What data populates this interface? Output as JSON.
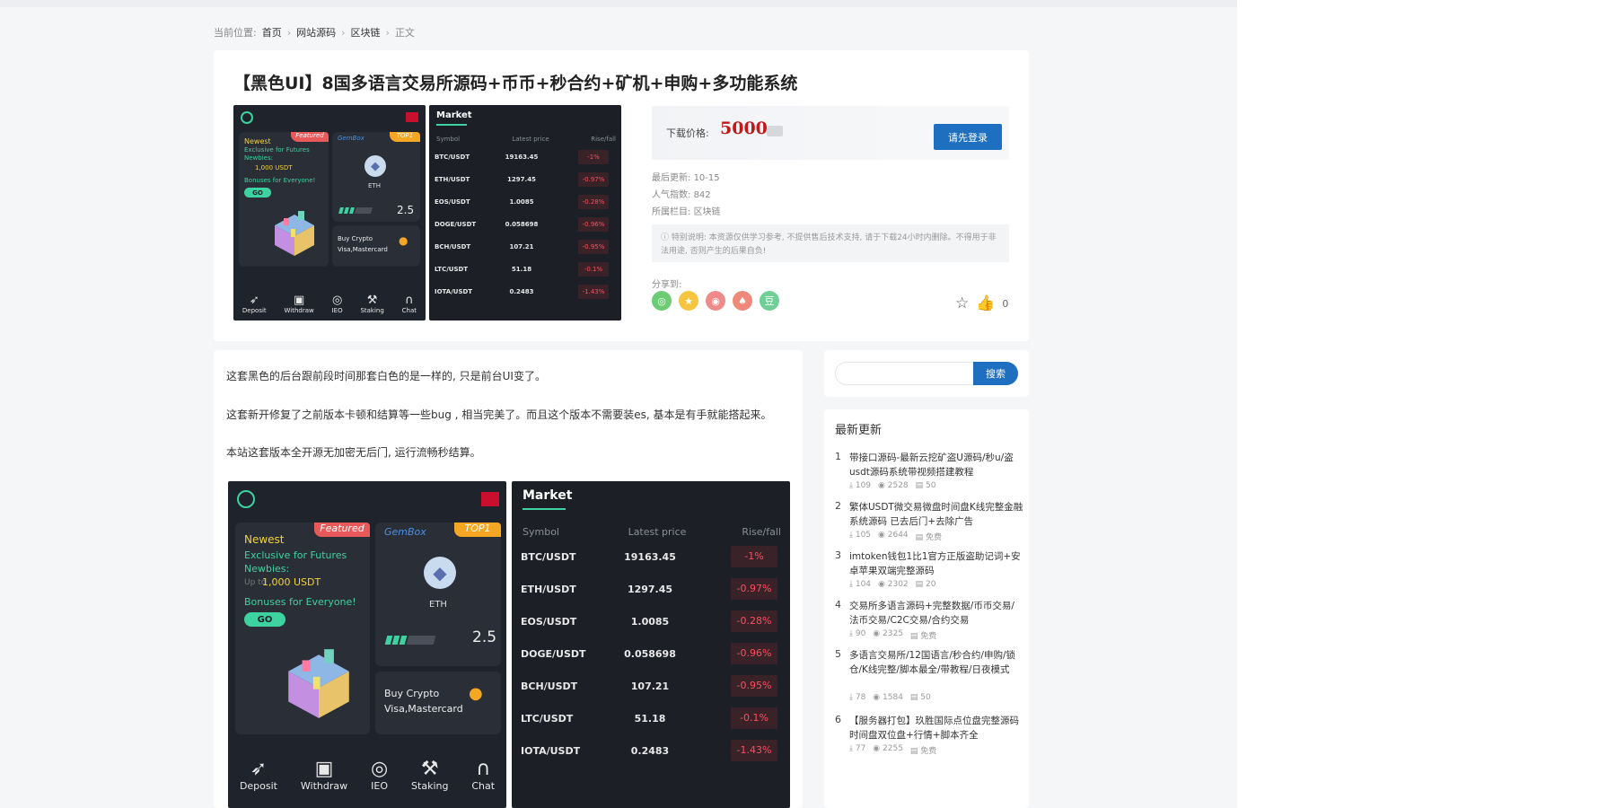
{
  "breadcrumb": {
    "prefix": "当前位置:",
    "items": [
      "首页",
      "网站源码",
      "区块链"
    ],
    "current": "正文"
  },
  "post": {
    "title": "【黑色UI】8国多语言交易所源码+币币+秒合约+矿机+申购+多功能系统",
    "price_label": "下载价格:",
    "price_value": "5000",
    "login_label": "请先登录",
    "meta": [
      {
        "label": "最后更新:",
        "value": "10-15"
      },
      {
        "label": "人气指数:",
        "value": "842"
      },
      {
        "label": "所属栏目:",
        "value": "区块链"
      }
    ],
    "notice": "ⓘ 特别说明: 本资源仅供学习参考, 不提供售后技术支持, 请于下载24小时内删除。不得用于非法用途, 否则产生的后果自负!",
    "share_label": "分享到:",
    "share_icons": [
      "wechat-icon",
      "qzone-icon",
      "weibo-icon",
      "qq-icon",
      "douban-icon"
    ],
    "share_glyphs": [
      "◎",
      "★",
      "◉",
      "♠",
      "豆"
    ],
    "like_count": "0"
  },
  "mockup": {
    "newest": "Newest",
    "featured": "Featured",
    "futures": "Exclusive for Futures Newbies:",
    "upto": "Up to",
    "amount": "1,000 USDT",
    "bonus": "Bonuses for Everyone!",
    "go": "GO",
    "gembox": "GemBox",
    "top1": "TOP1",
    "eth": "ETH",
    "eth_value": "2.5",
    "buy1": "Buy Crypto",
    "buy2": "Visa,Mastercard",
    "market": "Market",
    "col_symbol": "Symbol",
    "col_price": "Latest price",
    "col_change": "Rise/fall",
    "rows": [
      {
        "symbol": "BTC/USDT",
        "price": "19163.45",
        "change": "-1%"
      },
      {
        "symbol": "ETH/USDT",
        "price": "1297.45",
        "change": "-0.97%"
      },
      {
        "symbol": "EOS/USDT",
        "price": "1.0085",
        "change": "-0.28%"
      },
      {
        "symbol": "DOGE/USDT",
        "price": "0.058698",
        "change": "-0.96%"
      },
      {
        "symbol": "BCH/USDT",
        "price": "107.21",
        "change": "-0.95%"
      },
      {
        "symbol": "LTC/USDT",
        "price": "51.18",
        "change": "-0.1%"
      },
      {
        "symbol": "IOTA/USDT",
        "price": "0.2483",
        "change": "-1.43%"
      }
    ],
    "nav": [
      "Deposit",
      "Withdraw",
      "IEO",
      "Staking",
      "Chat"
    ]
  },
  "article": {
    "paragraphs": [
      "这套黑色的后台跟前段时间那套白色的是一样的, 只是前台UI变了。",
      "这套新开修复了之前版本卡顿和结算等一些bug , 相当完美了。而且这个版本不需要装es, 基本是有手就能搭起来。",
      "本站这套版本全开源无加密无后门, 运行流畅秒结算。"
    ]
  },
  "sidebar": {
    "search_placeholder": "",
    "search_label": "搜索",
    "recent_title": "最新更新",
    "recent": [
      {
        "title": "带接口源码-最新云挖矿盗U源码/秒u/盗usdt源码系统带视频搭建教程",
        "downloads": "109",
        "views": "2528",
        "price": "50"
      },
      {
        "title": "繁体USDT微交易微盘时间盘K线完整金融系统源码 已去后门+去除广告",
        "downloads": "105",
        "views": "2644",
        "price": "免费"
      },
      {
        "title": "imtoken钱包1比1官方正版盗助记词+安卓苹果双端完整源码",
        "downloads": "104",
        "views": "2302",
        "price": "20"
      },
      {
        "title": "交易所多语言源码+完整数据/币币交易/法币交易/C2C交易/合约交易",
        "downloads": "90",
        "views": "2325",
        "price": "免费"
      },
      {
        "title": "多语言交易所/12国语言/秒合约/申购/锁仓/K线完整/脚本最全/带教程/日夜模式",
        "downloads": "78",
        "views": "1584",
        "price": "50"
      },
      {
        "title": "【服务器打包】玖胜国际点位盘完整源码 时间盘双位盘+行情+脚本齐全",
        "downloads": "77",
        "views": "2255",
        "price": "免费"
      }
    ]
  },
  "colors": {
    "accent": "#1e6fbf",
    "price": "#c01919",
    "green": "#3ed2a0",
    "red": "#ff4d5e"
  }
}
